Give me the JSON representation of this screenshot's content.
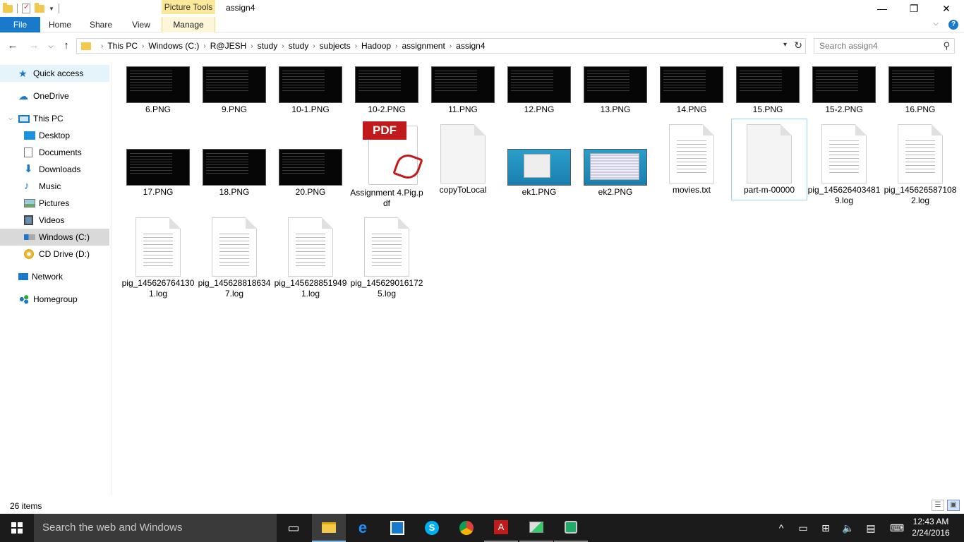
{
  "window": {
    "title": "assign4",
    "context_tab": "Picture Tools",
    "minimize_icon": "—",
    "maximize_icon": "❐",
    "close_icon": "✕"
  },
  "ribbon": {
    "tabs": [
      "File",
      "Home",
      "Share",
      "View",
      "Manage"
    ],
    "help_icon": "?"
  },
  "address": {
    "breadcrumbs": [
      "This PC",
      "Windows (C:)",
      "R@JESH",
      "study",
      "study",
      "subjects",
      "Hadoop",
      "assignment",
      "assign4"
    ],
    "search_placeholder": "Search assign4"
  },
  "nav": {
    "items": [
      {
        "label": "Quick access",
        "icon": "star-icon"
      },
      {
        "label": "OneDrive",
        "icon": "cloud-icon"
      },
      {
        "label": "This PC",
        "icon": "computer-icon"
      },
      {
        "label": "Desktop",
        "icon": "desktop-icon"
      },
      {
        "label": "Documents",
        "icon": "documents-icon"
      },
      {
        "label": "Downloads",
        "icon": "download-icon"
      },
      {
        "label": "Music",
        "icon": "music-icon"
      },
      {
        "label": "Pictures",
        "icon": "pictures-icon"
      },
      {
        "label": "Videos",
        "icon": "videos-icon"
      },
      {
        "label": "Windows (C:)",
        "icon": "drive-icon"
      },
      {
        "label": "CD Drive (D:)",
        "icon": "cd-icon"
      },
      {
        "label": "Network",
        "icon": "network-icon"
      },
      {
        "label": "Homegroup",
        "icon": "homegroup-icon"
      }
    ]
  },
  "files": [
    {
      "name": "6.PNG",
      "type": "png"
    },
    {
      "name": "9.PNG",
      "type": "png"
    },
    {
      "name": "10-1.PNG",
      "type": "png"
    },
    {
      "name": "10-2.PNG",
      "type": "png"
    },
    {
      "name": "11.PNG",
      "type": "png"
    },
    {
      "name": "12.PNG",
      "type": "png"
    },
    {
      "name": "13.PNG",
      "type": "png"
    },
    {
      "name": "14.PNG",
      "type": "png"
    },
    {
      "name": "15.PNG",
      "type": "png"
    },
    {
      "name": "15-2.PNG",
      "type": "png"
    },
    {
      "name": "16.PNG",
      "type": "png"
    },
    {
      "name": "17.PNG",
      "type": "png"
    },
    {
      "name": "18.PNG",
      "type": "png"
    },
    {
      "name": "20.PNG",
      "type": "png"
    },
    {
      "name": "Assignment 4.Pig.pdf",
      "type": "pdf"
    },
    {
      "name": "copyToLocal",
      "type": "blank"
    },
    {
      "name": "ek1.PNG",
      "type": "win"
    },
    {
      "name": "ek2.PNG",
      "type": "win2"
    },
    {
      "name": "movies.txt",
      "type": "text"
    },
    {
      "name": "part-m-00000",
      "type": "blank"
    },
    {
      "name": "pig_1456264034819.log",
      "type": "text"
    },
    {
      "name": "pig_1456265871082.log",
      "type": "text"
    },
    {
      "name": "pig_1456267641301.log",
      "type": "text"
    },
    {
      "name": "pig_1456288186347.log",
      "type": "text"
    },
    {
      "name": "pig_1456288519491.log",
      "type": "text"
    },
    {
      "name": "pig_1456290161725.log",
      "type": "text"
    }
  ],
  "pdf_badge": "PDF",
  "status": {
    "item_count": "26 items"
  },
  "taskbar": {
    "search_text": "Search the web and Windows",
    "apps": [
      "task-view-icon",
      "file-explorer-icon",
      "edge-icon",
      "store-icon",
      "skype-icon",
      "chrome-icon",
      "acrobat-icon",
      "network-app-icon",
      "lock-app-icon"
    ],
    "time": "12:43 AM",
    "date": "2/24/2016"
  },
  "colors": {
    "accent": "#1979ca",
    "tools_tab": "#fbe89a",
    "taskbar": "#1b1b1b"
  }
}
